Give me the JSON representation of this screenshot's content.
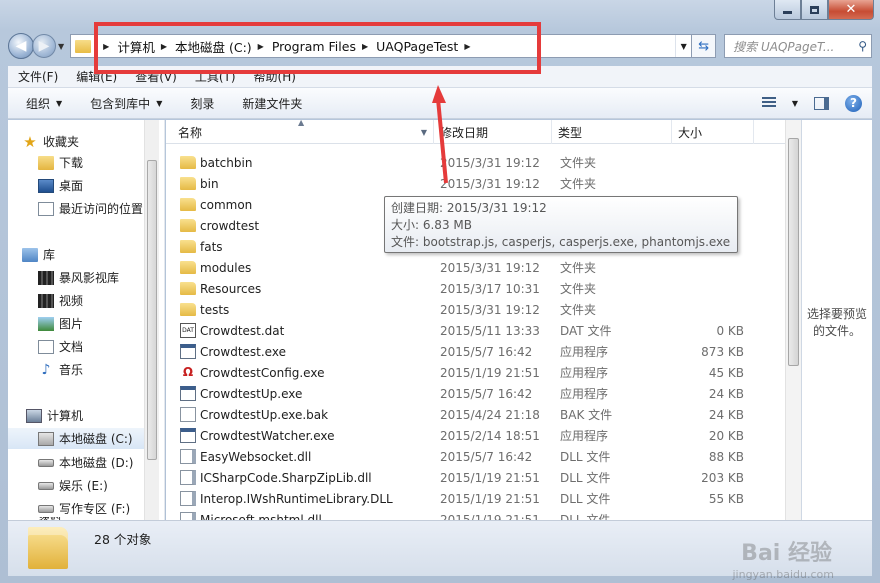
{
  "window": {
    "minimize_icon": "minimize-icon",
    "maximize_icon": "maximize-icon",
    "close_icon": "close-icon"
  },
  "nav": {
    "breadcrumb": [
      "计算机",
      "本地磁盘 (C:)",
      "Program Files",
      "UAQPageTest"
    ],
    "search_placeholder": "搜索 UAQPageT..."
  },
  "menubar": [
    "文件(F)",
    "编辑(E)",
    "查看(V)",
    "工具(T)",
    "帮助(H)"
  ],
  "toolbar": {
    "organize": "组织",
    "include_in_library": "包含到库中",
    "burn": "刻录",
    "new_folder": "新建文件夹"
  },
  "sidebar": {
    "favorites_title": "收藏夹",
    "favorites": [
      "下载",
      "桌面",
      "最近访问的位置"
    ],
    "libraries_title": "库",
    "libraries": [
      "暴风影视库",
      "视频",
      "图片",
      "文档",
      "音乐"
    ],
    "computer_title": "计算机",
    "drives": [
      "本地磁盘 (C:)",
      "本地磁盘 (D:)",
      "娱乐 (E:)",
      "写作专区 (F:)",
      "资料"
    ]
  },
  "columns": {
    "name": "名称",
    "date": "修改日期",
    "type": "类型",
    "size": "大小"
  },
  "files": [
    {
      "name": "batchbin",
      "date": "2015/3/31 19:12",
      "type": "文件夹",
      "size": "",
      "icon": "folder"
    },
    {
      "name": "bin",
      "date": "2015/3/31 19:12",
      "type": "文件夹",
      "size": "",
      "icon": "folder"
    },
    {
      "name": "common",
      "date": "",
      "type": "",
      "size": "",
      "icon": "folder"
    },
    {
      "name": "crowdtest",
      "date": "",
      "type": "",
      "size": "",
      "icon": "folder"
    },
    {
      "name": "fats",
      "date": "",
      "type": "",
      "size": "",
      "icon": "folder"
    },
    {
      "name": "modules",
      "date": "2015/3/31 19:12",
      "type": "文件夹",
      "size": "",
      "icon": "folder"
    },
    {
      "name": "Resources",
      "date": "2015/3/17 10:31",
      "type": "文件夹",
      "size": "",
      "icon": "folder"
    },
    {
      "name": "tests",
      "date": "2015/3/31 19:12",
      "type": "文件夹",
      "size": "",
      "icon": "folder"
    },
    {
      "name": "Crowdtest.dat",
      "date": "2015/5/11 13:33",
      "type": "DAT 文件",
      "size": "0 KB",
      "icon": "dat"
    },
    {
      "name": "Crowdtest.exe",
      "date": "2015/5/7 16:42",
      "type": "应用程序",
      "size": "873 KB",
      "icon": "exe"
    },
    {
      "name": "CrowdtestConfig.exe",
      "date": "2015/1/19 21:51",
      "type": "应用程序",
      "size": "45 KB",
      "icon": "red"
    },
    {
      "name": "CrowdtestUp.exe",
      "date": "2015/5/7 16:42",
      "type": "应用程序",
      "size": "24 KB",
      "icon": "exe"
    },
    {
      "name": "CrowdtestUp.exe.bak",
      "date": "2015/4/24 21:18",
      "type": "BAK 文件",
      "size": "24 KB",
      "icon": "doc"
    },
    {
      "name": "CrowdtestWatcher.exe",
      "date": "2015/2/14 18:51",
      "type": "应用程序",
      "size": "20 KB",
      "icon": "exe"
    },
    {
      "name": "EasyWebsocket.dll",
      "date": "2015/5/7 16:42",
      "type": "DLL 文件",
      "size": "88 KB",
      "icon": "dll"
    },
    {
      "name": "ICSharpCode.SharpZipLib.dll",
      "date": "2015/1/19 21:51",
      "type": "DLL 文件",
      "size": "203 KB",
      "icon": "dll"
    },
    {
      "name": "Interop.IWshRuntimeLibrary.DLL",
      "date": "2015/1/19 21:51",
      "type": "DLL 文件",
      "size": "55 KB",
      "icon": "dll"
    },
    {
      "name": "Microsoft.mshtml.dll",
      "date": "2015/1/19 21:51",
      "type": "DLL 文件",
      "size": "",
      "icon": "dll"
    }
  ],
  "tooltip": {
    "created": "创建日期: 2015/3/31 19:12",
    "size": "大小: 6.83 MB",
    "files": "文件: bootstrap.js, casperjs, casperjs.exe, phantomjs.exe, ..."
  },
  "preview_text": "选择要预览的文件。",
  "status": "28 个对象",
  "watermark": "Bai 经验",
  "watermark_url": "jingyan.baidu.com",
  "colors": {
    "highlight": "#e53b3b"
  }
}
